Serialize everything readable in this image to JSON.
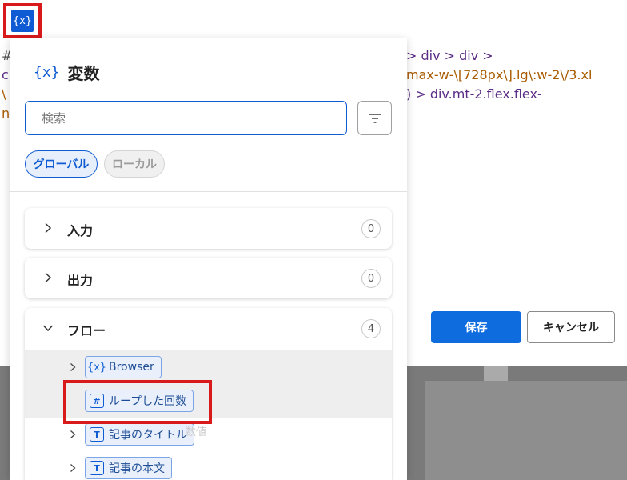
{
  "toolbar": {
    "toggle_icon_text": "{x}",
    "toggle_icon": "variable-icon"
  },
  "background": {
    "code_left": [
      "#",
      "c",
      "\\",
      "n"
    ],
    "code_line1_purple": "> div > div >",
    "code_line2_orange": "max-w-\\[728px\\].lg\\:w-2\\/3.xl",
    "code_line3_purple": ") > div.mt-2.flex.flex-",
    "save_label": "保存",
    "cancel_label": "キャンセル"
  },
  "panel": {
    "icon_text": "{x}",
    "title": "変数",
    "search": {
      "placeholder": "検索",
      "value": ""
    },
    "filter_icon": "filter-icon",
    "tabs": [
      {
        "label": "グローバル",
        "selected": true
      },
      {
        "label": "ローカル",
        "selected": false
      }
    ],
    "sections": [
      {
        "label": "入力",
        "count": "0",
        "expanded": false
      },
      {
        "label": "出力",
        "count": "0",
        "expanded": false
      },
      {
        "label": "フロー",
        "count": "4",
        "expanded": true
      }
    ],
    "flow_items": [
      {
        "icon": "variable-icon",
        "icon_text": "{x}",
        "label": "Browser",
        "has_chevron": true,
        "highlighted": true
      },
      {
        "icon": "number-icon",
        "icon_text": "#",
        "label": "ループした回数",
        "has_chevron": false,
        "highlighted": true
      },
      {
        "icon": "text-icon",
        "icon_text": "T",
        "label": "記事のタイトル",
        "has_chevron": true,
        "highlighted": false
      },
      {
        "icon": "text-icon",
        "icon_text": "T",
        "label": "記事の本文",
        "has_chevron": true,
        "highlighted": false
      }
    ],
    "ghost_text": "数値"
  },
  "colors": {
    "accent": "#0f5bd3",
    "button_primary": "#0f6cdf",
    "annotation_red": "#d91a1a"
  }
}
